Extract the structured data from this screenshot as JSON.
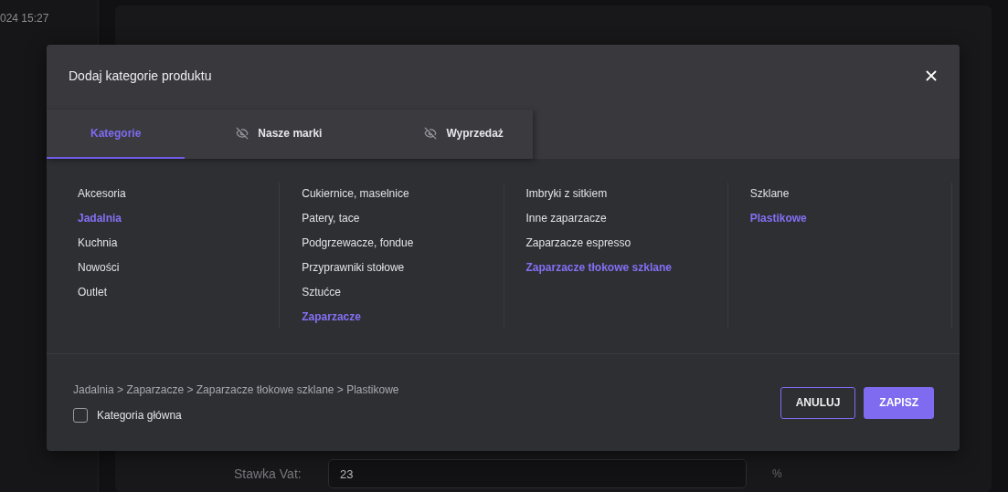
{
  "background": {
    "timestamp": "024 15:27",
    "vat_label": "Stawka Vat:",
    "vat_value": "23",
    "vat_unit": "%"
  },
  "modal": {
    "title": "Dodaj kategorie produktu",
    "tabs": [
      {
        "label": "Kategorie",
        "selected": true,
        "hidden": false
      },
      {
        "label": "Nasze marki",
        "selected": false,
        "hidden": true
      },
      {
        "label": "Wyprzedaż",
        "selected": false,
        "hidden": true
      }
    ],
    "columns": [
      {
        "items": [
          {
            "label": "Akcesoria",
            "selected": false
          },
          {
            "label": "Jadalnia",
            "selected": true
          },
          {
            "label": "Kuchnia",
            "selected": false
          },
          {
            "label": "Nowości",
            "selected": false
          },
          {
            "label": "Outlet",
            "selected": false
          }
        ]
      },
      {
        "items": [
          {
            "label": "Cukiernice, maselnice",
            "selected": false
          },
          {
            "label": "Patery, tace",
            "selected": false
          },
          {
            "label": "Podgrzewacze, fondue",
            "selected": false
          },
          {
            "label": "Przyprawniki stołowe",
            "selected": false
          },
          {
            "label": "Sztućce",
            "selected": false
          },
          {
            "label": "Zaparzacze",
            "selected": true
          }
        ]
      },
      {
        "items": [
          {
            "label": "Imbryki z sitkiem",
            "selected": false
          },
          {
            "label": "Inne zaparzacze",
            "selected": false
          },
          {
            "label": "Zaparzacze espresso",
            "selected": false
          },
          {
            "label": "Zaparzacze tłokowe szklane",
            "selected": true
          }
        ]
      },
      {
        "items": [
          {
            "label": "Szklane",
            "selected": false
          },
          {
            "label": "Plastikowe",
            "selected": true
          }
        ]
      }
    ],
    "breadcrumb": "Jadalnia > Zaparzacze > Zaparzacze tłokowe szklane > Plastikowe",
    "main_category": {
      "label": "Kategoria główna",
      "checked": false
    },
    "buttons": [
      {
        "label": "ANULUJ",
        "kind": "outline"
      },
      {
        "label": "ZAPISZ",
        "kind": "primary"
      }
    ]
  }
}
